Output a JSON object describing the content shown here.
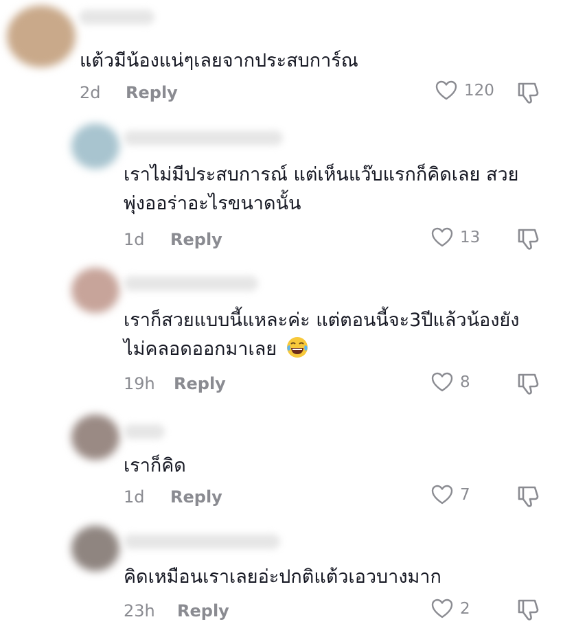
{
  "comments": [
    {
      "text_lines": [
        "แต้วมีน้องแน่ๆเลยจากประสบการ์ณ"
      ],
      "time": "2d",
      "reply_label": "Reply",
      "likes": "120",
      "avatar_color": "#c9a98a"
    },
    {
      "text_lines": [
        "เราไม่มีประสบการณ์ แต่เห็นแว๊บแรกก็คิดเลย สวย",
        "พุ่งออร่าอะไรขนาดนั้น"
      ],
      "time": "1d",
      "reply_label": "Reply",
      "likes": "13",
      "avatar_color": "#a8c4cf"
    },
    {
      "text_lines": [
        "เราก็สวยแบบนี้แหละค่ะ แต่ตอนนี้จะ3ปีแล้วน้องยัง",
        "ไม่คลอดออกมาเลย"
      ],
      "emoji": "face-with-tears-of-joy-icon",
      "time": "19h",
      "reply_label": "Reply",
      "likes": "8",
      "avatar_color": "#c7a49a"
    },
    {
      "text_lines": [
        "เราก็คิด"
      ],
      "time": "1d",
      "reply_label": "Reply",
      "likes": "7",
      "avatar_color": "#9a8a84"
    },
    {
      "text_lines": [
        "คิดเหมือนเราเลยอ่ะปกติแต้วเอวบางมาก"
      ],
      "time": "23h",
      "reply_label": "Reply",
      "likes": "2",
      "avatar_color": "#8f8580"
    }
  ],
  "icons": {
    "like": "heart-outline-icon",
    "dislike": "thumbs-down-outline-icon"
  },
  "colors": {
    "text": "#161823",
    "meta": "#8a8b91"
  }
}
